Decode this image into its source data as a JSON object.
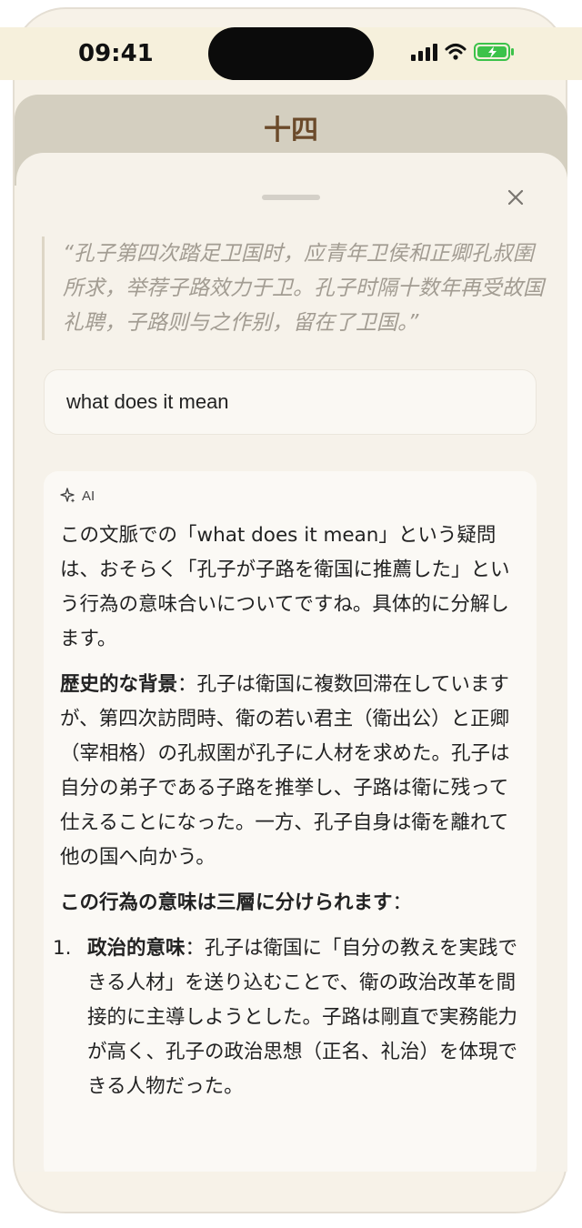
{
  "status_bar": {
    "time": "09:41"
  },
  "header": {
    "chapter_title": "十四"
  },
  "quote": {
    "text": "“孔子第四次踏足卫国时，应青年卫侯和正卿孔叔圉所求，举荐子路效力于卫。孔子时隔十数年再受故国礼聘，子路则与之作别，留在了卫国。”"
  },
  "input": {
    "value": "what does it mean"
  },
  "ai": {
    "label": "AI",
    "intro": "この文脈での「what does it mean」という疑問は、おそらく「孔子が子路を衛国に推薦した」という行為の意味合いについてですね。具体的に分解します。",
    "background_heading": "歴史的な背景",
    "background_text": "：孔子は衛国に複数回滞在していますが、第四次訪問時、衛の若い君主（衛出公）と正卿（宰相格）の孔叔圉が孔子に人材を求めた。孔子は自分の弟子である子路を推挙し、子路は衛に残って仕えることになった。一方、孔子自身は衛を離れて他の国へ向かう。",
    "layers_heading": "この行為の意味は三層に分けられます",
    "layers_colon": "：",
    "list": [
      {
        "num": "1.",
        "heading": "政治的意味",
        "text": "：孔子は衛国に「自分の教えを実践できる人材」を送り込むことで、衛の政治改革を間接的に主導しようとした。子路は剛直で実務能力が高く、孔子の政治思想（正名、礼治）を体現できる人物だった。"
      }
    ]
  },
  "icons": {
    "close": "close-icon",
    "ai": "sparkle-icon"
  }
}
